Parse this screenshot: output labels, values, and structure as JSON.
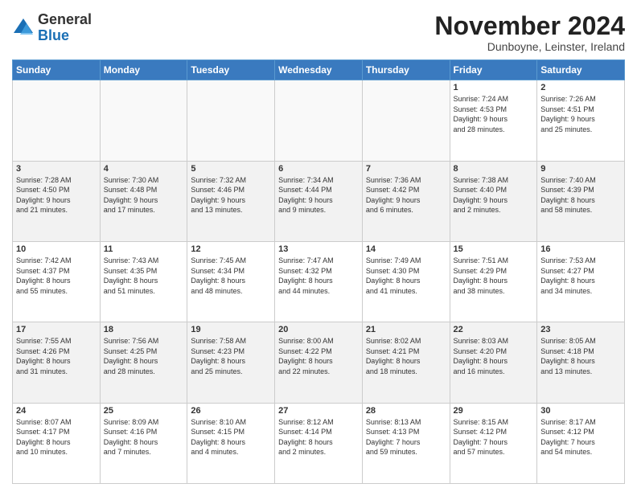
{
  "logo": {
    "general": "General",
    "blue": "Blue"
  },
  "header": {
    "month": "November 2024",
    "location": "Dunboyne, Leinster, Ireland"
  },
  "weekdays": [
    "Sunday",
    "Monday",
    "Tuesday",
    "Wednesday",
    "Thursday",
    "Friday",
    "Saturday"
  ],
  "weeks": [
    [
      {
        "day": "",
        "info": ""
      },
      {
        "day": "",
        "info": ""
      },
      {
        "day": "",
        "info": ""
      },
      {
        "day": "",
        "info": ""
      },
      {
        "day": "",
        "info": ""
      },
      {
        "day": "1",
        "info": "Sunrise: 7:24 AM\nSunset: 4:53 PM\nDaylight: 9 hours\nand 28 minutes."
      },
      {
        "day": "2",
        "info": "Sunrise: 7:26 AM\nSunset: 4:51 PM\nDaylight: 9 hours\nand 25 minutes."
      }
    ],
    [
      {
        "day": "3",
        "info": "Sunrise: 7:28 AM\nSunset: 4:50 PM\nDaylight: 9 hours\nand 21 minutes."
      },
      {
        "day": "4",
        "info": "Sunrise: 7:30 AM\nSunset: 4:48 PM\nDaylight: 9 hours\nand 17 minutes."
      },
      {
        "day": "5",
        "info": "Sunrise: 7:32 AM\nSunset: 4:46 PM\nDaylight: 9 hours\nand 13 minutes."
      },
      {
        "day": "6",
        "info": "Sunrise: 7:34 AM\nSunset: 4:44 PM\nDaylight: 9 hours\nand 9 minutes."
      },
      {
        "day": "7",
        "info": "Sunrise: 7:36 AM\nSunset: 4:42 PM\nDaylight: 9 hours\nand 6 minutes."
      },
      {
        "day": "8",
        "info": "Sunrise: 7:38 AM\nSunset: 4:40 PM\nDaylight: 9 hours\nand 2 minutes."
      },
      {
        "day": "9",
        "info": "Sunrise: 7:40 AM\nSunset: 4:39 PM\nDaylight: 8 hours\nand 58 minutes."
      }
    ],
    [
      {
        "day": "10",
        "info": "Sunrise: 7:42 AM\nSunset: 4:37 PM\nDaylight: 8 hours\nand 55 minutes."
      },
      {
        "day": "11",
        "info": "Sunrise: 7:43 AM\nSunset: 4:35 PM\nDaylight: 8 hours\nand 51 minutes."
      },
      {
        "day": "12",
        "info": "Sunrise: 7:45 AM\nSunset: 4:34 PM\nDaylight: 8 hours\nand 48 minutes."
      },
      {
        "day": "13",
        "info": "Sunrise: 7:47 AM\nSunset: 4:32 PM\nDaylight: 8 hours\nand 44 minutes."
      },
      {
        "day": "14",
        "info": "Sunrise: 7:49 AM\nSunset: 4:30 PM\nDaylight: 8 hours\nand 41 minutes."
      },
      {
        "day": "15",
        "info": "Sunrise: 7:51 AM\nSunset: 4:29 PM\nDaylight: 8 hours\nand 38 minutes."
      },
      {
        "day": "16",
        "info": "Sunrise: 7:53 AM\nSunset: 4:27 PM\nDaylight: 8 hours\nand 34 minutes."
      }
    ],
    [
      {
        "day": "17",
        "info": "Sunrise: 7:55 AM\nSunset: 4:26 PM\nDaylight: 8 hours\nand 31 minutes."
      },
      {
        "day": "18",
        "info": "Sunrise: 7:56 AM\nSunset: 4:25 PM\nDaylight: 8 hours\nand 28 minutes."
      },
      {
        "day": "19",
        "info": "Sunrise: 7:58 AM\nSunset: 4:23 PM\nDaylight: 8 hours\nand 25 minutes."
      },
      {
        "day": "20",
        "info": "Sunrise: 8:00 AM\nSunset: 4:22 PM\nDaylight: 8 hours\nand 22 minutes."
      },
      {
        "day": "21",
        "info": "Sunrise: 8:02 AM\nSunset: 4:21 PM\nDaylight: 8 hours\nand 18 minutes."
      },
      {
        "day": "22",
        "info": "Sunrise: 8:03 AM\nSunset: 4:20 PM\nDaylight: 8 hours\nand 16 minutes."
      },
      {
        "day": "23",
        "info": "Sunrise: 8:05 AM\nSunset: 4:18 PM\nDaylight: 8 hours\nand 13 minutes."
      }
    ],
    [
      {
        "day": "24",
        "info": "Sunrise: 8:07 AM\nSunset: 4:17 PM\nDaylight: 8 hours\nand 10 minutes."
      },
      {
        "day": "25",
        "info": "Sunrise: 8:09 AM\nSunset: 4:16 PM\nDaylight: 8 hours\nand 7 minutes."
      },
      {
        "day": "26",
        "info": "Sunrise: 8:10 AM\nSunset: 4:15 PM\nDaylight: 8 hours\nand 4 minutes."
      },
      {
        "day": "27",
        "info": "Sunrise: 8:12 AM\nSunset: 4:14 PM\nDaylight: 8 hours\nand 2 minutes."
      },
      {
        "day": "28",
        "info": "Sunrise: 8:13 AM\nSunset: 4:13 PM\nDaylight: 7 hours\nand 59 minutes."
      },
      {
        "day": "29",
        "info": "Sunrise: 8:15 AM\nSunset: 4:12 PM\nDaylight: 7 hours\nand 57 minutes."
      },
      {
        "day": "30",
        "info": "Sunrise: 8:17 AM\nSunset: 4:12 PM\nDaylight: 7 hours\nand 54 minutes."
      }
    ]
  ]
}
